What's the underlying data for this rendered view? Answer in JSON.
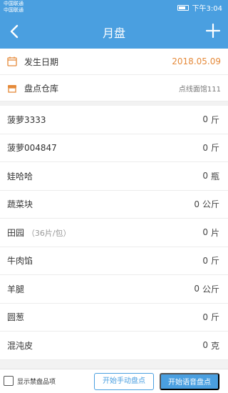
{
  "status_bar": {
    "carrier_1": "中国联通",
    "carrier_2": "中国联通",
    "time": "下午3:04"
  },
  "nav": {
    "title": "月盘",
    "back_icon": "chevron-left-icon",
    "add_icon": "plus-icon"
  },
  "info": {
    "date_label": "发生日期",
    "date_value": "2018.05.09",
    "warehouse_label": "盘点仓库",
    "warehouse_value": "点线面馆111",
    "date_icon": "calendar-icon",
    "warehouse_icon": "store-icon",
    "accent_color": "#e58a3a",
    "brand_color": "#4a9fe0"
  },
  "items": [
    {
      "name": "菠萝3333",
      "spec": "",
      "qty": "0",
      "unit": "斤"
    },
    {
      "name": "菠萝004847",
      "spec": "",
      "qty": "0",
      "unit": "斤"
    },
    {
      "name": "娃哈哈",
      "spec": "",
      "qty": "0",
      "unit": "瓶"
    },
    {
      "name": "蔬菜块",
      "spec": "",
      "qty": "0",
      "unit": "公斤"
    },
    {
      "name": "田园",
      "spec": "（36片/包）",
      "qty": "0",
      "unit": "片"
    },
    {
      "name": "牛肉馅",
      "spec": "",
      "qty": "0",
      "unit": "斤"
    },
    {
      "name": "羊腿",
      "spec": "",
      "qty": "0",
      "unit": "公斤"
    },
    {
      "name": "圆葱",
      "spec": "",
      "qty": "0",
      "unit": "斤"
    },
    {
      "name": "混沌皮",
      "spec": "",
      "qty": "0",
      "unit": "克"
    }
  ],
  "bottom": {
    "checkbox_label": "显示禁盘品项",
    "manual_button": "开始手动盘点",
    "voice_button": "开始语音盘点"
  }
}
